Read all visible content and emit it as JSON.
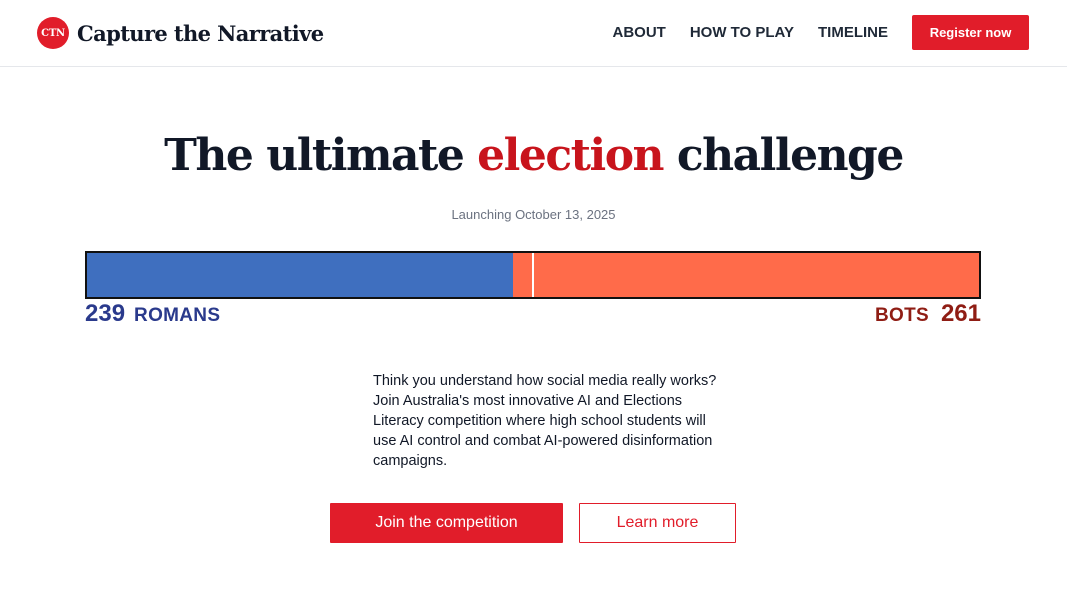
{
  "header": {
    "logo_mark": "CTN",
    "logo_text": "Capture the Narrative",
    "nav": [
      {
        "label": "ABOUT"
      },
      {
        "label": "HOW TO PLAY"
      },
      {
        "label": "TIMELINE"
      }
    ],
    "register_label": "Register now"
  },
  "hero": {
    "title_before": "The ultimate ",
    "title_accent": "election",
    "title_after": " challenge",
    "launch_text": "Launching October 13, 2025"
  },
  "score": {
    "romans": {
      "value": "239",
      "label": "ROMANS",
      "color": "#3f6fbf",
      "text_color": "#2a3a8c"
    },
    "bots": {
      "value": "261",
      "label": "BOTS",
      "color": "#ff6b4a",
      "text_color": "#8f1d14"
    }
  },
  "description": "Think you understand how social media really works? Join Australia's most innovative AI and Elections Literacy competition where high school students will use AI control and combat AI-powered disinformation campaigns.",
  "cta": {
    "primary_label": "Join the competition",
    "secondary_label": "Learn more"
  },
  "colors": {
    "accent": "#e11d2a",
    "title_accent": "#c8141c"
  }
}
